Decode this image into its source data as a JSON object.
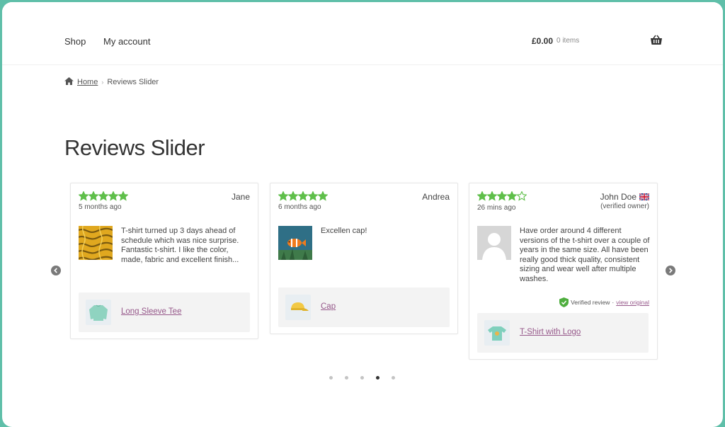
{
  "header": {
    "nav": [
      {
        "label": "Shop"
      },
      {
        "label": "My account"
      }
    ],
    "cart_total": "£0.00",
    "cart_count": "0 items",
    "cart_icon": "basket-icon"
  },
  "breadcrumb": {
    "home_icon": "home-icon",
    "home": "Home",
    "separator": "›",
    "current": "Reviews Slider"
  },
  "page": {
    "title": "Reviews Slider"
  },
  "slider": {
    "prev_icon": "chevron-left-icon",
    "next_icon": "chevron-right-icon",
    "star_color": "#5fbf4a",
    "reviews": [
      {
        "stars": 5,
        "reviewer": "Jane",
        "date": "5 months ago",
        "text": "T-shirt turned up 3 days ahead of schedule which was nice surprise. Fantastic t-shirt. I like the color, made, fabric and excellent finish...",
        "product": "Long Sleeve Tee"
      },
      {
        "stars": 5,
        "reviewer": "Andrea",
        "date": "6 months ago",
        "text": "Excellen cap!",
        "product": "Cap"
      },
      {
        "stars": 4,
        "reviewer": "John Doe",
        "reviewer_note": "(verified owner)",
        "flag_icon": "uk-flag-icon",
        "date": "26 mins ago",
        "text": "Have order around 4 different versions of the t-shirt over a couple of years in the same size. All have been really good thick quality, consistent sizing and wear well after multiple washes.",
        "verified_label": "Verified review",
        "verified_sep": "·",
        "view_original": "view original",
        "product": "T-Shirt with Logo"
      }
    ],
    "pagination": {
      "count": 5,
      "active": 4
    }
  }
}
